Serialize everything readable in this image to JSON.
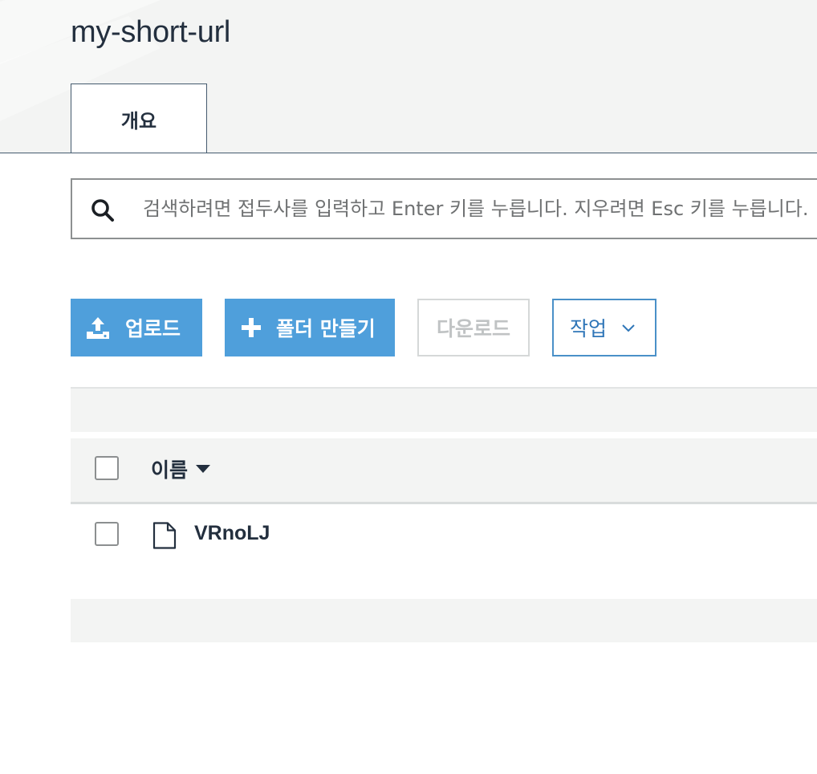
{
  "bucket": {
    "name": "my-short-url"
  },
  "tabs": [
    {
      "label": "개요",
      "active": true
    }
  ],
  "search": {
    "placeholder": "검색하려면 접두사를 입력하고 Enter 키를 누릅니다. 지우려면 Esc 키를 누릅니다.",
    "icon": "search-icon"
  },
  "toolbar": {
    "upload_label": "업로드",
    "create_folder_label": "폴더 만들기",
    "download_label": "다운로드",
    "actions_label": "작업"
  },
  "table": {
    "columns": [
      {
        "label": "이름",
        "sort": "descending"
      }
    ],
    "rows": [
      {
        "type": "file",
        "name": "VRnoLJ"
      }
    ]
  },
  "colors": {
    "primary_button": "#4f9fdb",
    "actions_border": "#4a90c8",
    "header_bg": "#f3f4f3",
    "text": "#232f3e",
    "disabled_text": "#c0c3c4"
  }
}
